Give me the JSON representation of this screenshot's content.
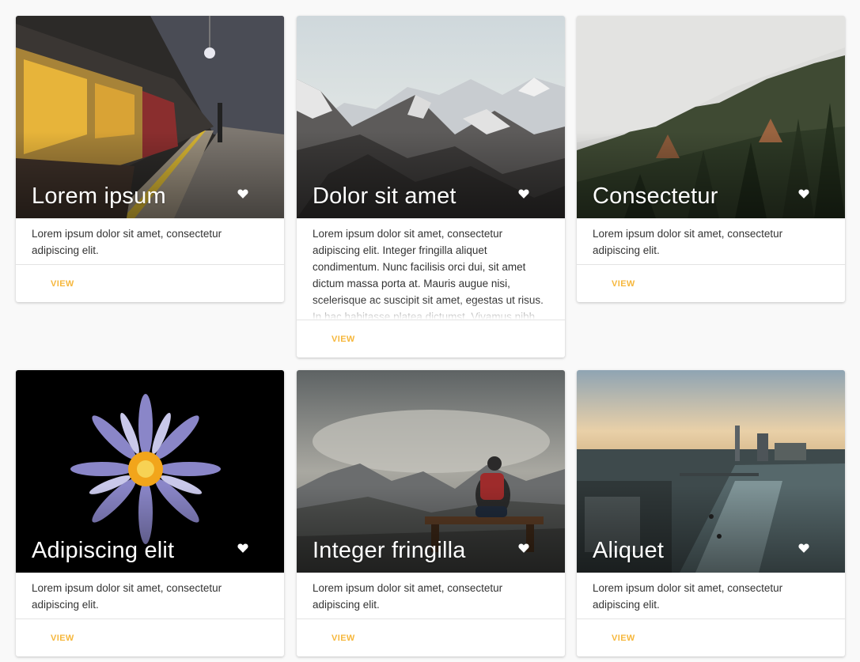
{
  "accent_color": "#f6b73c",
  "cards": [
    {
      "title": "Lorem ipsum",
      "text": "Lorem ipsum dolor sit amet, consectetur adipiscing elit.",
      "action": "VIEW",
      "image": "subway-train-photo",
      "icon": "heart-icon"
    },
    {
      "title": "Dolor sit amet",
      "text": "Lorem ipsum dolor sit amet, consectetur adipiscing elit. Integer fringilla aliquet condimentum. Nunc facilisis orci dui, sit amet dictum massa porta at. Mauris augue nisi, scelerisque ac suscipit sit amet, egestas ut risus. In hac habitasse platea dictumst. Vivamus nibh",
      "action": "VIEW",
      "image": "snowy-mountains-photo",
      "icon": "heart-icon"
    },
    {
      "title": "Consectetur",
      "text": "Lorem ipsum dolor sit amet, consectetur adipiscing elit.",
      "action": "VIEW",
      "image": "misty-forest-photo",
      "icon": "heart-icon"
    },
    {
      "title": "Adipiscing elit",
      "text": "Lorem ipsum dolor sit amet, consectetur adipiscing elit.",
      "action": "VIEW",
      "image": "water-lily-photo",
      "icon": "heart-icon"
    },
    {
      "title": "Integer fringilla",
      "text": "Lorem ipsum dolor sit amet, consectetur adipiscing elit.",
      "action": "VIEW",
      "image": "hiker-on-bench-photo",
      "icon": "heart-icon"
    },
    {
      "title": "Aliquet",
      "text": "Lorem ipsum dolor sit amet, consectetur adipiscing elit.",
      "action": "VIEW",
      "image": "city-river-photo",
      "icon": "heart-icon"
    }
  ]
}
